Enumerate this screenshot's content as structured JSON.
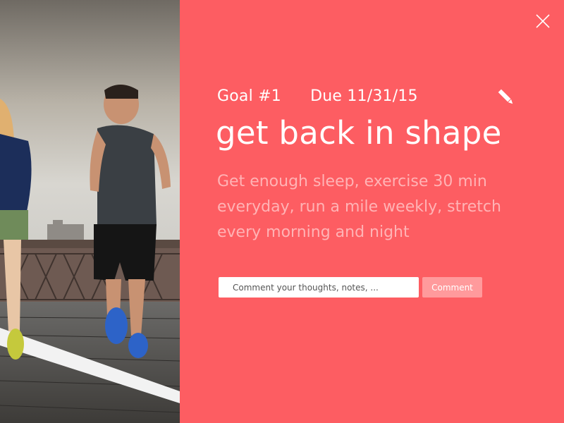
{
  "photo": {
    "alt": "Two people running on a bridge"
  },
  "goal": {
    "number_label": "Goal #1",
    "due_label": "Due 11/31/15",
    "title": "get back in shape",
    "description": "Get enough sleep, exercise 30 min everyday, run a mile weekly, stretch every morning and night"
  },
  "comment": {
    "placeholder": "Comment your thoughts, notes, ...",
    "value": "",
    "button_label": "Comment"
  },
  "icons": {
    "close": "close-icon",
    "edit": "pencil-icon"
  },
  "colors": {
    "panel_background": "#fd5d62",
    "description_text": "#ffb3b5",
    "comment_button": "#ff9a9c",
    "primary_text": "#ffffff"
  }
}
